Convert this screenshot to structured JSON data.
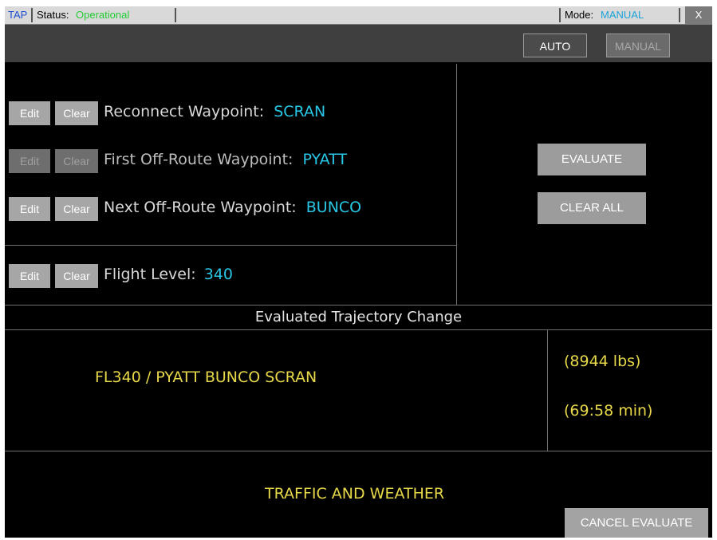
{
  "titlebar": {
    "app": "TAP",
    "status_label": "Status:",
    "status_value": "Operational",
    "mode_label": "Mode:",
    "mode_value": "MANUAL",
    "close_label": "X"
  },
  "toolbar": {
    "auto_label": "AUTO",
    "manual_label": "MANUAL"
  },
  "waypoints": [
    {
      "edit_label": "Edit",
      "clear_label": "Clear",
      "label": "Reconnect Waypoint:",
      "value": "SCRAN",
      "enabled": true
    },
    {
      "edit_label": "Edit",
      "clear_label": "Clear",
      "label": "First Off-Route Waypoint:",
      "value": "PYATT",
      "enabled": false
    },
    {
      "edit_label": "Edit",
      "clear_label": "Clear",
      "label": "Next Off-Route Waypoint:",
      "value": "BUNCO",
      "enabled": true
    }
  ],
  "flight_level": {
    "edit_label": "Edit",
    "clear_label": "Clear",
    "label": "Flight Level:",
    "value": "340"
  },
  "actions": {
    "evaluate_label": "EVALUATE",
    "clear_all_label": "CLEAR ALL"
  },
  "evaluation": {
    "header": "Evaluated Trajectory Change",
    "route": "FL340 / PYATT BUNCO SCRAN",
    "fuel": "(8944 lbs)",
    "time": "(69:58 min)",
    "advisory": "TRAFFIC AND WEATHER",
    "cancel_label": "CANCEL EVALUATE"
  },
  "colors": {
    "accent_cyan": "#29c6e6",
    "status_green": "#22cc33",
    "result_yellow": "#e7d84a",
    "app_blue": "#1f4fd0"
  }
}
